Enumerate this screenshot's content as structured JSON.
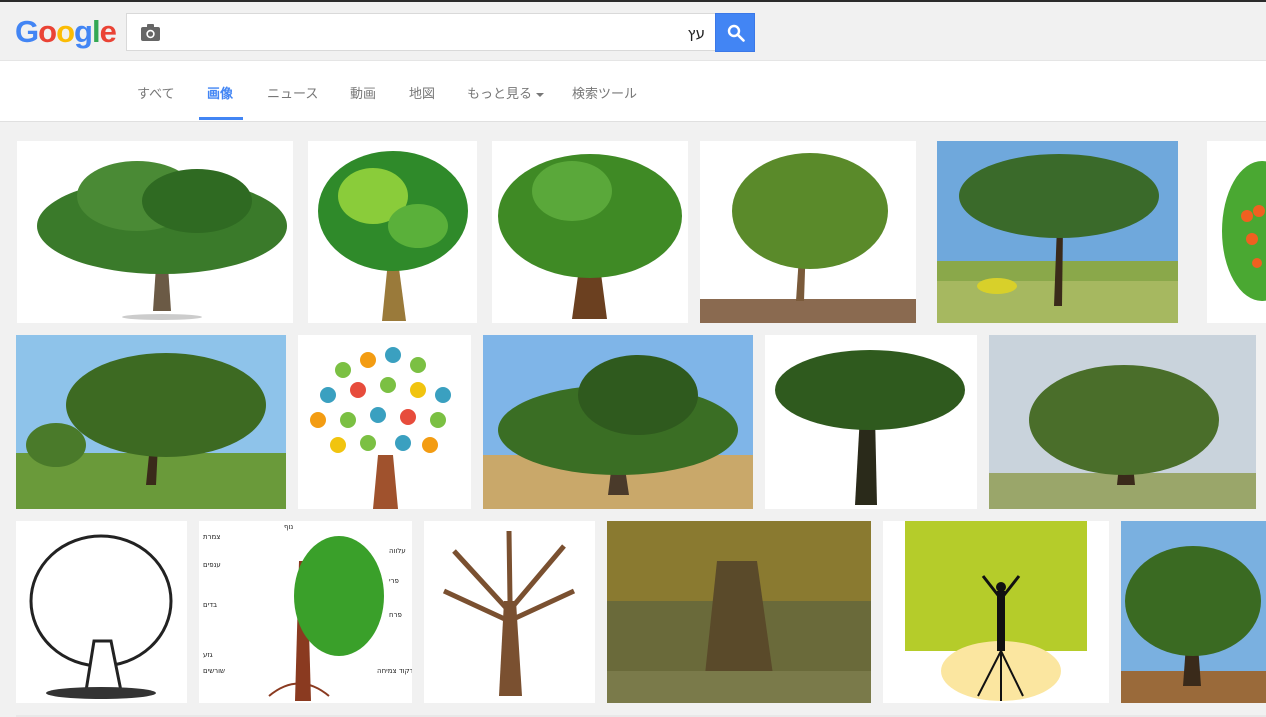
{
  "logo": {
    "letters": [
      "G",
      "o",
      "o",
      "g",
      "l",
      "e"
    ],
    "colors": [
      "#4285f4",
      "#ea4335",
      "#fbbc05",
      "#4285f4",
      "#34a853",
      "#ea4335"
    ]
  },
  "search": {
    "query": "עץ",
    "camera_icon": "camera-icon",
    "search_icon": "search-icon",
    "button_color": "#4285f4"
  },
  "tabs": [
    {
      "label": "すべて",
      "active": false
    },
    {
      "label": "画像",
      "active": true
    },
    {
      "label": "ニュース",
      "active": false
    },
    {
      "label": "動画",
      "active": false
    },
    {
      "label": "地図",
      "active": false
    },
    {
      "label": "もっと見る",
      "active": false
    },
    {
      "label": "検索ツール",
      "active": false
    }
  ],
  "diagram_labels": {
    "top": "נוף",
    "left": [
      "צמרת",
      "ענפים",
      "בדים",
      "גזע",
      "שורשים"
    ],
    "right": [
      "עלווה",
      "פרי",
      "פרח",
      "קודקוד צמיחה"
    ]
  },
  "results": [
    {
      "desc": "oak tree on white",
      "bg": "#ffffff",
      "canopy": "#3a7a2a",
      "trunk": "#6b5a45"
    },
    {
      "desc": "cartoon tree",
      "bg": "#ffffff",
      "canopy": "#4aa832",
      "trunk": "#9a7a3a"
    },
    {
      "desc": "olive tree",
      "bg": "#ffffff",
      "canopy": "#3f8a25",
      "trunk": "#6b4020"
    },
    {
      "desc": "small tree on gravel",
      "bg": "#ffffff",
      "canopy": "#5a8a2a",
      "trunk": "#7a5a3a"
    },
    {
      "desc": "pine tree landscape",
      "bg": "#6fa8dc",
      "canopy": "#3a6a2a",
      "trunk": "#3a2a1a"
    },
    {
      "desc": "orange tree cartoon",
      "bg": "#ffffff",
      "canopy": "#4aa832",
      "trunk": "#7a5a3a"
    },
    {
      "desc": "tree in grass field",
      "bg": "#8ec3ea",
      "canopy": "#3d6a22",
      "trunk": "#3a2a1a"
    },
    {
      "desc": "tree of colorful hands",
      "bg": "#ffffff",
      "canopy": "#7bc043",
      "trunk": "#a0522d"
    },
    {
      "desc": "wide tree in desert",
      "bg": "#7fb5e8",
      "canopy": "#3a6e24",
      "trunk": "#4a3a2a"
    },
    {
      "desc": "banyan tree",
      "bg": "#ffffff",
      "canopy": "#2f5a1e",
      "trunk": "#2a2a1a"
    },
    {
      "desc": "large oak in meadow",
      "bg": "#c9d3dc",
      "canopy": "#4a6e2a",
      "trunk": "#3a2a1a"
    },
    {
      "desc": "tree line drawing",
      "bg": "#ffffff",
      "canopy": "#ffffff",
      "trunk": "#222222"
    },
    {
      "desc": "tree parts diagram",
      "bg": "#ffffff",
      "canopy": "#3aa02a",
      "trunk": "#8a3a20"
    },
    {
      "desc": "bare tree",
      "bg": "#ffffff",
      "canopy": "#ffffff",
      "trunk": "#7a5030"
    },
    {
      "desc": "ancient tree trunk",
      "bg": "#6a6a3a",
      "canopy": "#8a7a30",
      "trunk": "#5a4a2a"
    },
    {
      "desc": "man with roots",
      "bg": "#ffffff",
      "canopy": "#b5cc2a",
      "trunk": "#111111"
    },
    {
      "desc": "tree on blue sky",
      "bg": "#7ab0e0",
      "canopy": "#3a6a22",
      "trunk": "#3a2a1a"
    }
  ]
}
